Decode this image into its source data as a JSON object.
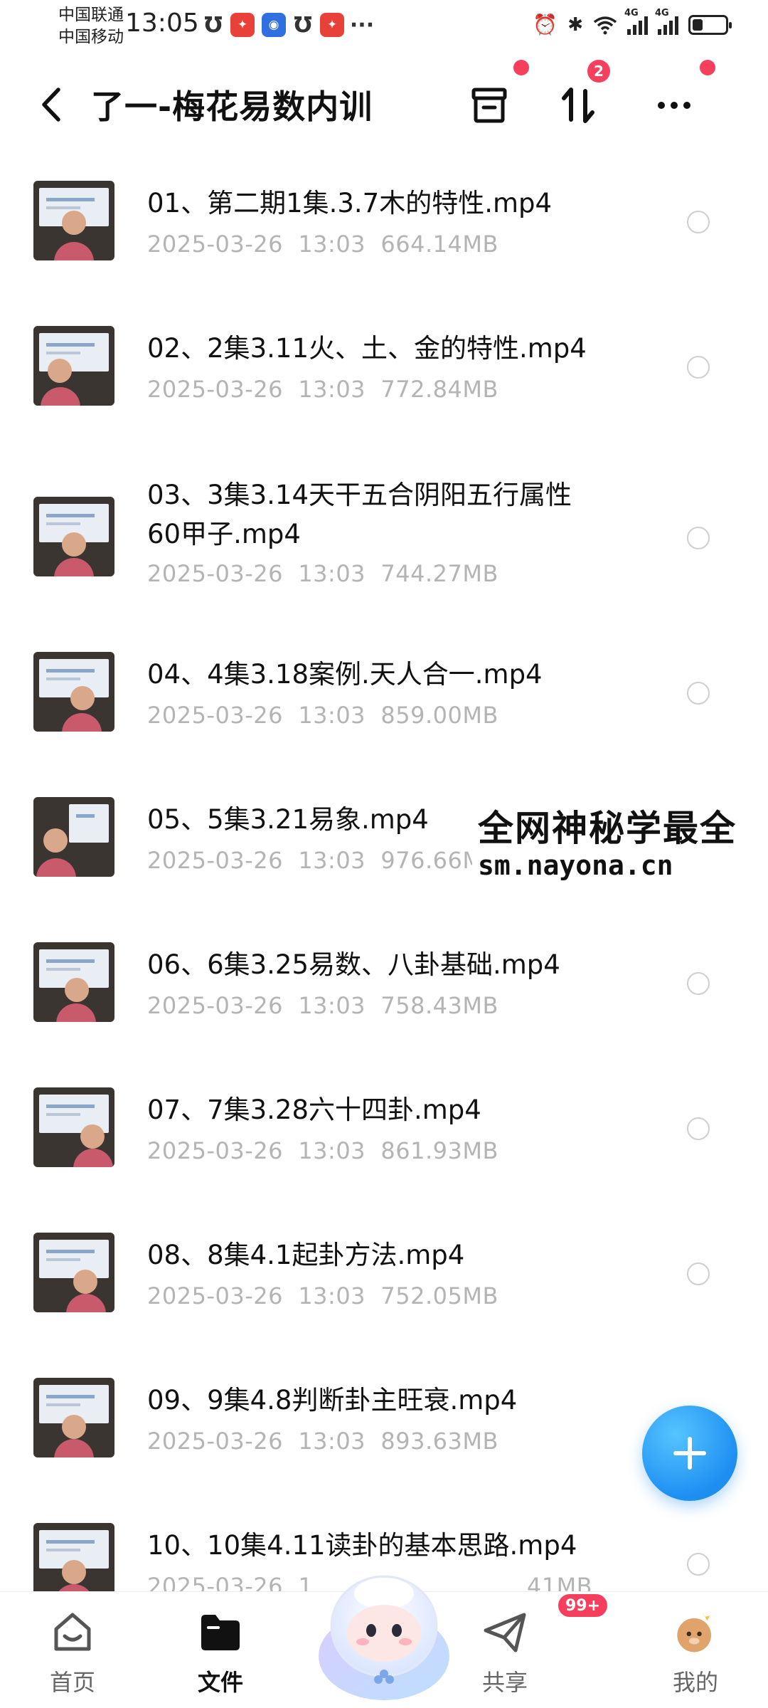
{
  "status_bar": {
    "carrier1": "中国联通",
    "carrier2": "中国移动",
    "time": "13:05",
    "notif_u": "Ʊ",
    "notif_more": "···",
    "network1": "4G",
    "network2": "4G"
  },
  "header": {
    "title": "了一-梅花易数内训",
    "transfer_badge": "2"
  },
  "files": [
    {
      "name": "01、第二期1集.3.7木的特性.mp4",
      "date": "2025-03-26",
      "time": "13:03",
      "size": "664.14MB"
    },
    {
      "name": "02、2集3.11火、土、金的特性.mp4",
      "date": "2025-03-26",
      "time": "13:03",
      "size": "772.84MB"
    },
    {
      "name": "03、3集3.14天干五合阴阳五行属性",
      "name2": "60甲子.mp4",
      "date": "2025-03-26",
      "time": "13:03",
      "size": "744.27MB"
    },
    {
      "name": "04、4集3.18案例.天人合一.mp4",
      "date": "2025-03-26",
      "time": "13:03",
      "size": "859.00MB"
    },
    {
      "name": "05、5集3.21易象.mp4",
      "date": "2025-03-26",
      "time": "13:03",
      "size": "976.66M"
    },
    {
      "name": "06、6集3.25易数、八卦基础.mp4",
      "date": "2025-03-26",
      "time": "13:03",
      "size": "758.43MB"
    },
    {
      "name": "07、7集3.28六十四卦.mp4",
      "date": "2025-03-26",
      "time": "13:03",
      "size": "861.93MB"
    },
    {
      "name": "08、8集4.1起卦方法.mp4",
      "date": "2025-03-26",
      "time": "13:03",
      "size": "752.05MB"
    },
    {
      "name": "09、9集4.8判断卦主旺衰.mp4",
      "date": "2025-03-26",
      "time": "13:03",
      "size": "893.63MB"
    },
    {
      "name": "10、10集4.11读卦的基本思路.mp4",
      "date": "2025-03-26",
      "time": "1",
      "size": ".41MB"
    }
  ],
  "watermark": {
    "line1": "全网神秘学最全",
    "line2": "sm.nayona.cn"
  },
  "bottom_nav": {
    "home": "首页",
    "files": "文件",
    "share": "共享",
    "share_badge": "99+",
    "mine": "我的"
  },
  "colors": {
    "accent": "#1e8ff2",
    "badge": "#f53f5d",
    "meta_gray": "#b4b4b4"
  }
}
